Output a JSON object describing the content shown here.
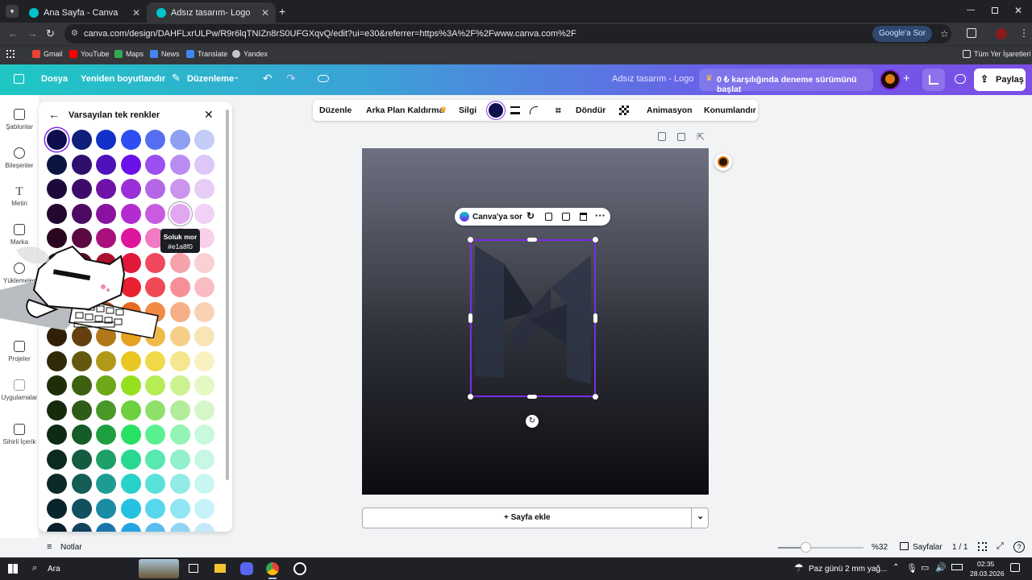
{
  "browser": {
    "tabs": [
      {
        "title": "Ana Sayfa - Canva"
      },
      {
        "title": "Adsız tasarım- Logo"
      }
    ],
    "url": "canva.com/design/DAHFLxrULPw/R9r6lqTNIZn8rS0UFGXqvQ/edit?ui=e30&referrer=https%3A%2F%2Fwww.canva.com%2F",
    "google_button": "Google'a Sor",
    "bookmarks": [
      "Gmail",
      "YouTube",
      "Maps",
      "News",
      "Translate",
      "Yandex"
    ],
    "all_bookmarks": "Tüm Yer İşaretleri"
  },
  "header": {
    "file": "Dosya",
    "resize": "Yeniden boyutlandır",
    "edit": "Düzenleme",
    "design_title": "Adsız tasarım - Logo",
    "trial": "0 ₺ karşılığında deneme sürümünü başlat",
    "share": "Paylaş"
  },
  "sidebar": {
    "items": [
      {
        "label": "Şablonlar"
      },
      {
        "label": "Bileşenler"
      },
      {
        "label": "Metin"
      },
      {
        "label": "Marka"
      },
      {
        "label": "Yüklemeler"
      },
      {
        "label": "Projeler"
      },
      {
        "label": "Uygulamalar"
      },
      {
        "label": "Sihirli İçerik"
      }
    ]
  },
  "color_panel": {
    "title": "Varsayılan tek renkler",
    "tooltip_name": "Soluk mor",
    "tooltip_hex": "#e1a8f0",
    "swatches": [
      [
        "#0d0d4d",
        "#0f1f7a",
        "#1131c9",
        "#2f4ef2",
        "#5470f0",
        "#8fa0f2",
        "#c3cbf7"
      ],
      [
        "#0b1540",
        "#2e0f6e",
        "#4e12b8",
        "#6a10e8",
        "#9b4ff0",
        "#b98cf2",
        "#dcc7f7"
      ],
      [
        "#1e0a3a",
        "#3d0c6b",
        "#6e12a8",
        "#9a2fd8",
        "#b566e6",
        "#cb95ec",
        "#e6cdf6"
      ],
      [
        "#22082e",
        "#4c0a63",
        "#8a12a0",
        "#b22cd0",
        "#c95be0",
        "#e1a8f0",
        "#f0d2f6"
      ],
      [
        "#2a0620",
        "#5c0a42",
        "#a8107e",
        "#e0159e",
        "#f07ac4",
        "#f5a8d8",
        "#f8d0ea"
      ],
      [
        "#2c0a10",
        "#5c0c1c",
        "#a8102c",
        "#e0183a",
        "#f0485c",
        "#f5a2ac",
        "#fad0d4"
      ],
      [
        "#300a0a",
        "#641010",
        "#b01818",
        "#e82030",
        "#f04a56",
        "#f59098",
        "#f9bcc2"
      ],
      [
        "#301408",
        "#642a10",
        "#b04a18",
        "#e86a20",
        "#f08a44",
        "#f5b088",
        "#f9d2b6"
      ],
      [
        "#302008",
        "#644010",
        "#b07818",
        "#e8a020",
        "#f0ba48",
        "#f5cf88",
        "#f9e4b6"
      ],
      [
        "#302a08",
        "#645810",
        "#b09818",
        "#e8c820",
        "#f0da4a",
        "#f5e690",
        "#f9f1c2"
      ],
      [
        "#1e2e08",
        "#3e6010",
        "#6ea818",
        "#96e020",
        "#b6ec54",
        "#cdf290",
        "#e4f8c4"
      ],
      [
        "#162a0c",
        "#2e5c18",
        "#4a9828",
        "#6ed040",
        "#8ee06a",
        "#b2ec9a",
        "#d6f6ca"
      ],
      [
        "#0c2a14",
        "#145c28",
        "#1ea040",
        "#28e064",
        "#5af090",
        "#94f4b6",
        "#c8f9dc"
      ],
      [
        "#0c2a1e",
        "#145c40",
        "#1ea068",
        "#28d890",
        "#58e8b0",
        "#92f0cc",
        "#c8f7e4"
      ],
      [
        "#0c2a28",
        "#145c56",
        "#1e9c94",
        "#28d2c8",
        "#5ae2da",
        "#92ece6",
        "#c8f6f2"
      ],
      [
        "#0a242c",
        "#12505e",
        "#1a8ca4",
        "#24c2e0",
        "#58d6ec",
        "#92e6f4",
        "#c6f3fa"
      ],
      [
        "#0a1e2c",
        "#12425e",
        "#1a76a8",
        "#24a4e4",
        "#58bcee",
        "#92d4f4",
        "#c6e9fa"
      ]
    ]
  },
  "toolbar": {
    "edit": "Düzenle",
    "bg_remove": "Arka Plan Kaldırma",
    "eraser": "Silgi",
    "rotate": "Döndür",
    "animate": "Animasyon",
    "position": "Konumlandır"
  },
  "context_menu": {
    "ask": "Canva'ya sor"
  },
  "add_page": "+ Sayfa ekle",
  "footer": {
    "notes": "Notlar",
    "zoom": "%32",
    "zoom_level": 0.32,
    "pages": "Sayfalar",
    "page_count": "1 / 1"
  },
  "taskbar": {
    "search": "Ara",
    "weather": "Paz günü 2 mm yağ...",
    "time": "02:35",
    "date": "28.03.2026"
  },
  "colors": {
    "accent": "#7d2ae8",
    "selected_color": "#0d0d4d"
  }
}
